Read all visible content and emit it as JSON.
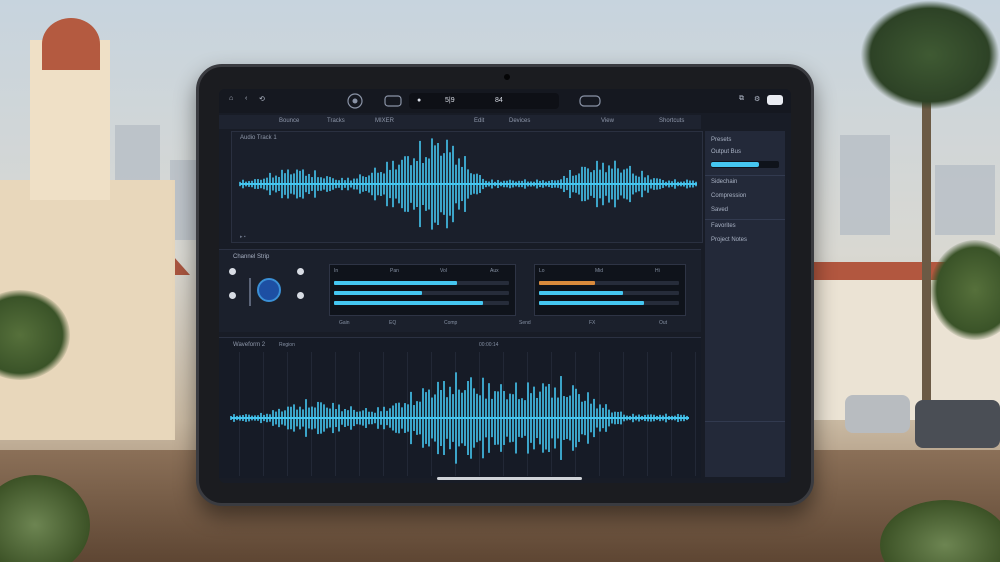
{
  "app": {
    "topbar": {
      "left_buttons": [
        "⌂",
        "‹",
        "⟲"
      ],
      "transport": {
        "left_icon": "●",
        "position": "5|9",
        "tempo": "84"
      },
      "right_buttons": [
        "⧉",
        "⚙"
      ]
    },
    "menubar": [
      "Bounce",
      "Tracks",
      "MIXER",
      "Edit",
      "Devices",
      "View",
      "Shortcuts"
    ],
    "track1": {
      "label": "Audio Track 1",
      "footer": "▸ ▪"
    },
    "mixer": {
      "title": "Channel Strip",
      "labels": [
        "Gain",
        "EQ",
        "Comp",
        "Send",
        "FX",
        "Out"
      ],
      "panel1_labels": [
        "In",
        "Pan",
        "Vol",
        "Aux"
      ],
      "panel2_labels": [
        "Lo",
        "Mid",
        "Hi"
      ]
    },
    "track2": {
      "label": "Waveform 2",
      "marker": "Region",
      "ruler": "00:00:14"
    },
    "sidebar": {
      "items": [
        "Presets",
        "Output Bus",
        "Sidechain",
        "Compression",
        "Saved",
        "Favorites",
        "Project Notes"
      ]
    },
    "colors": {
      "waveform": "#45c6f0",
      "accent": "#3a8fd6",
      "meter_orange": "#d98a3c"
    },
    "meter_levels": {
      "panel1": [
        0.7,
        0.5,
        0.85
      ],
      "panel2": [
        0.4,
        0.6,
        0.75
      ],
      "sidebar_fill": 0.7
    }
  }
}
